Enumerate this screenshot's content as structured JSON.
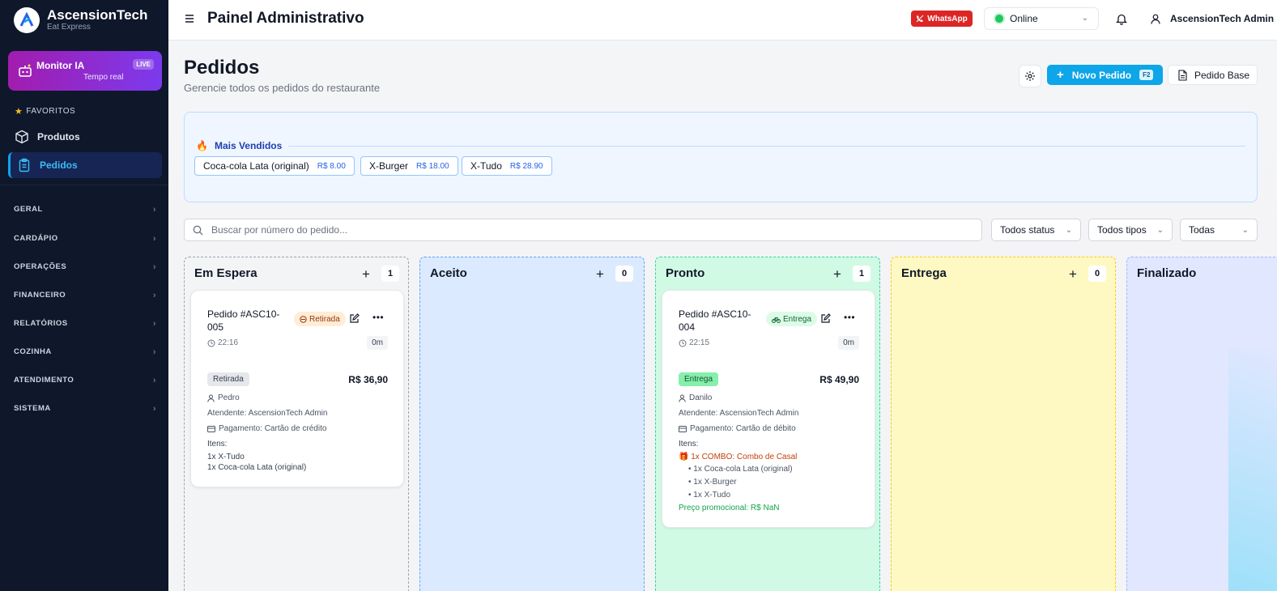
{
  "brand": {
    "name": "AscensionTech",
    "sub": "Eat Express"
  },
  "monitor": {
    "title": "Monitor IA",
    "sub": "Tempo real",
    "badge": "LIVE"
  },
  "sidebar": {
    "favorites_header": "FAVORITOS",
    "favorites": [
      {
        "label": "Produtos",
        "icon": "box-icon"
      },
      {
        "label": "Pedidos",
        "icon": "clipboard-icon",
        "active": true
      }
    ],
    "groups": [
      "GERAL",
      "CARDÁPIO",
      "OPERAÇÕES",
      "FINANCEIRO",
      "RELATÓRIOS",
      "COZINHA",
      "ATENDIMENTO",
      "SISTEMA"
    ]
  },
  "header": {
    "title": "Painel Administrativo",
    "whatsapp": "WhatsApp",
    "status": "Online",
    "user": "AscensionTech Admin"
  },
  "page": {
    "title": "Pedidos",
    "subtitle": "Gerencie todos os pedidos do restaurante",
    "new_order": "Novo Pedido",
    "new_order_key": "F2",
    "base_order": "Pedido Base"
  },
  "bestsellers": {
    "title": "Mais Vendidos",
    "items": [
      {
        "name": "Coca-cola Lata (original)",
        "price": "R$ 8.00"
      },
      {
        "name": "X-Burger",
        "price": "R$ 18.00"
      },
      {
        "name": "X-Tudo",
        "price": "R$ 28.90"
      }
    ]
  },
  "search": {
    "placeholder": "Buscar por número do pedido..."
  },
  "filters": {
    "status": "Todos status",
    "types": "Todos tipos",
    "all": "Todas"
  },
  "columns": [
    {
      "title": "Em Espera",
      "count": "1"
    },
    {
      "title": "Aceito",
      "count": "0"
    },
    {
      "title": "Pronto",
      "count": "1"
    },
    {
      "title": "Entrega",
      "count": "0"
    },
    {
      "title": "Finalizado"
    }
  ],
  "orders": [
    {
      "id_line1": "Pedido #ASC10-",
      "id_line2": "005",
      "type": "Retirada",
      "time": "22:16",
      "elapsed": "0m",
      "pill": "Retirada",
      "total": "R$ 36,90",
      "customer": "Pedro",
      "attendant": "Atendente: AscensionTech Admin",
      "payment": "Pagamento: Cartão de crédito",
      "items_label": "Itens:",
      "items": [
        "1x X-Tudo",
        "1x Coca-cola Lata (original)"
      ]
    },
    {
      "id_line1": "Pedido #ASC10-",
      "id_line2": "004",
      "type": "Entrega",
      "time": "22:15",
      "elapsed": "0m",
      "pill": "Entrega",
      "total": "R$ 49,90",
      "customer": "Danilo",
      "attendant": "Atendente: AscensionTech Admin",
      "payment": "Pagamento: Cartão de débito",
      "items_label": "Itens:",
      "combo": "1x COMBO: Combo de Casal",
      "combo_items": [
        "• 1x Coca-cola Lata (original)",
        "• 1x X-Burger",
        "• 1x X-Tudo"
      ],
      "promo": "Preço promocional: R$ NaN"
    }
  ],
  "colors": {
    "sidebar_bg": "#0f172a",
    "accent": "#0ea5e9",
    "whatsapp_red": "#dc2626",
    "col_waiting": "#f3f4f6",
    "col_accepted": "#dbeafe",
    "col_ready": "#d1fae5",
    "col_delivery": "#fef9c3",
    "col_done": "#e0e7ff"
  }
}
